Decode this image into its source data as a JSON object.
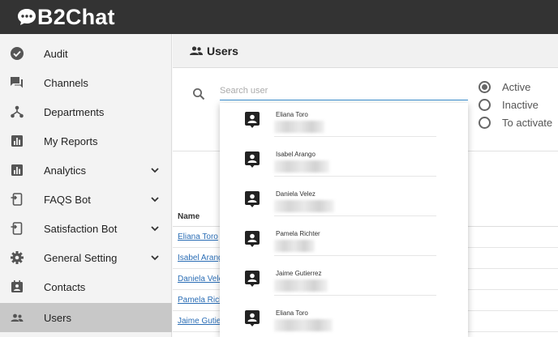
{
  "app": {
    "name": "B2Chat"
  },
  "sidebar": {
    "items": [
      {
        "label": "Audit",
        "icon": "check-circle-icon",
        "has_chevron": false,
        "active": false
      },
      {
        "label": "Channels",
        "icon": "chat-icon",
        "has_chevron": false,
        "active": false
      },
      {
        "label": "Departments",
        "icon": "hierarchy-icon",
        "has_chevron": false,
        "active": false
      },
      {
        "label": "My Reports",
        "icon": "bar-chart-icon",
        "has_chevron": false,
        "active": false
      },
      {
        "label": "Analytics",
        "icon": "bar-chart-icon",
        "has_chevron": true,
        "active": false
      },
      {
        "label": "FAQS Bot",
        "icon": "bot-icon",
        "has_chevron": true,
        "active": false
      },
      {
        "label": "Satisfaction Bot",
        "icon": "bot-icon",
        "has_chevron": true,
        "active": false
      },
      {
        "label": "General Setting",
        "icon": "gear-icon",
        "has_chevron": true,
        "active": false
      },
      {
        "label": "Contacts",
        "icon": "contacts-icon",
        "has_chevron": false,
        "active": false
      },
      {
        "label": "Users",
        "icon": "users-icon",
        "has_chevron": false,
        "active": true
      }
    ]
  },
  "header": {
    "title": "Users",
    "icon": "users-icon"
  },
  "search": {
    "placeholder": "Search user",
    "value": ""
  },
  "filters": {
    "options": [
      {
        "label": "Active",
        "checked": true
      },
      {
        "label": "Inactive",
        "checked": false
      },
      {
        "label": "To activate",
        "checked": false
      }
    ]
  },
  "table": {
    "column_name": "Name",
    "rows": [
      "Eliana Toro",
      "Isabel Arango",
      "Daniela Velez",
      "Pamela Richter",
      "Jaime Gutierrez"
    ]
  },
  "dropdown": {
    "items": [
      "Eliana Toro",
      "Isabel Arango",
      "Daniela Velez",
      "Pamela Richter",
      "Jaime Gutierrez",
      "Eliana Toro"
    ]
  },
  "colors": {
    "topbar": "#333333",
    "link": "#2a6db5",
    "focus_underline": "#3b8fd1",
    "active_item": "#c8c8c8"
  }
}
